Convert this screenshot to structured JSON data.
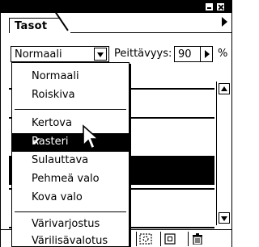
{
  "panel": {
    "tab_label": "Tasot"
  },
  "options": {
    "blend_mode": "Normaali",
    "opacity_label": "Peittävyys:",
    "opacity_value": "90",
    "percent_sign": "%"
  },
  "blend_menu": {
    "items": [
      {
        "label": "Normaali"
      },
      {
        "label": "Roiskiva"
      },
      {
        "label": "Kertova"
      },
      {
        "label": "Rasteri",
        "checked": true,
        "highlighted": true
      },
      {
        "label": "Sulauttava"
      },
      {
        "label": "Pehmeä valo"
      },
      {
        "label": "Kova valo"
      },
      {
        "label": "Värivarjostus"
      },
      {
        "label": "Värilisävalotus"
      }
    ],
    "check_glyph": "✔"
  },
  "icons": {
    "menu_arrow": "menu-arrow-icon",
    "minimize": "minimize-icon",
    "close": "close-icon",
    "mask": "layer-mask-icon",
    "new_layer": "new-layer-icon",
    "trash": "trash-icon",
    "cursor": "arrow-cursor-icon"
  }
}
